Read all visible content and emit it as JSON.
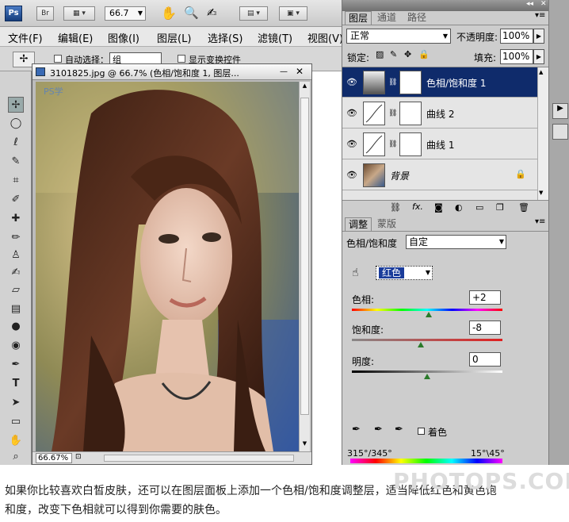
{
  "appbar": {
    "ps_logo": "Ps",
    "br_button": "Br",
    "zoom": "66.7",
    "icons": [
      "hand-icon",
      "zoom-icon",
      "rotate-view-icon",
      "arrange-icon",
      "screen-mode-icon"
    ]
  },
  "menu": [
    "文件(F)",
    "编辑(E)",
    "图像(I)",
    "图层(L)",
    "选择(S)",
    "滤镜(T)",
    "视图(V)"
  ],
  "options": {
    "auto_select_label": "自动选择：",
    "auto_select_value": "组",
    "show_transform_label": "显示变换控件"
  },
  "document": {
    "title": "3101825.jpg @ 66.7% (色相/饱和度 1, 图层...",
    "zoom_field": "66.67%",
    "watermark": "PS学"
  },
  "layers_panel": {
    "tabs": [
      "图层",
      "通道",
      "路径"
    ],
    "blend_mode": "正常",
    "opacity_label": "不透明度:",
    "opacity_value": "100%",
    "lock_label": "锁定:",
    "fill_label": "填充:",
    "fill_value": "100%",
    "layers": [
      {
        "name": "色相/饱和度 1",
        "selected": true
      },
      {
        "name": "曲线 2",
        "selected": false
      },
      {
        "name": "曲线 1",
        "selected": false
      },
      {
        "name": "背景",
        "selected": false
      }
    ]
  },
  "adjustments_panel": {
    "tabs": [
      "调整",
      "蒙版"
    ],
    "adjust_label": "色相/饱和度",
    "preset_value": "自定",
    "channel_value": "红色",
    "hue_label": "色相:",
    "hue_value": "+2",
    "saturation_label": "饱和度:",
    "saturation_value": "-8",
    "lightness_label": "明度:",
    "lightness_value": "0",
    "colorize_label": "着色",
    "range_left": "315°/345°",
    "range_right": "15°\\45°",
    "hue_level": 0.51,
    "sat_level": 0.46,
    "light_level": 0.5
  },
  "caption": {
    "line1": "如果你比较喜欢白皙皮肤，还可以在图层面板上添加一个色相/饱和度调整层，适当降低红色和黄色饱",
    "line2": "和度，改变下色相就可以得到你需要的肤色。",
    "watermark": "PHOTOPS.COM"
  },
  "colors": {
    "selected_layer": "#0f2b6b",
    "ps_blue": "#2a5aa6"
  }
}
